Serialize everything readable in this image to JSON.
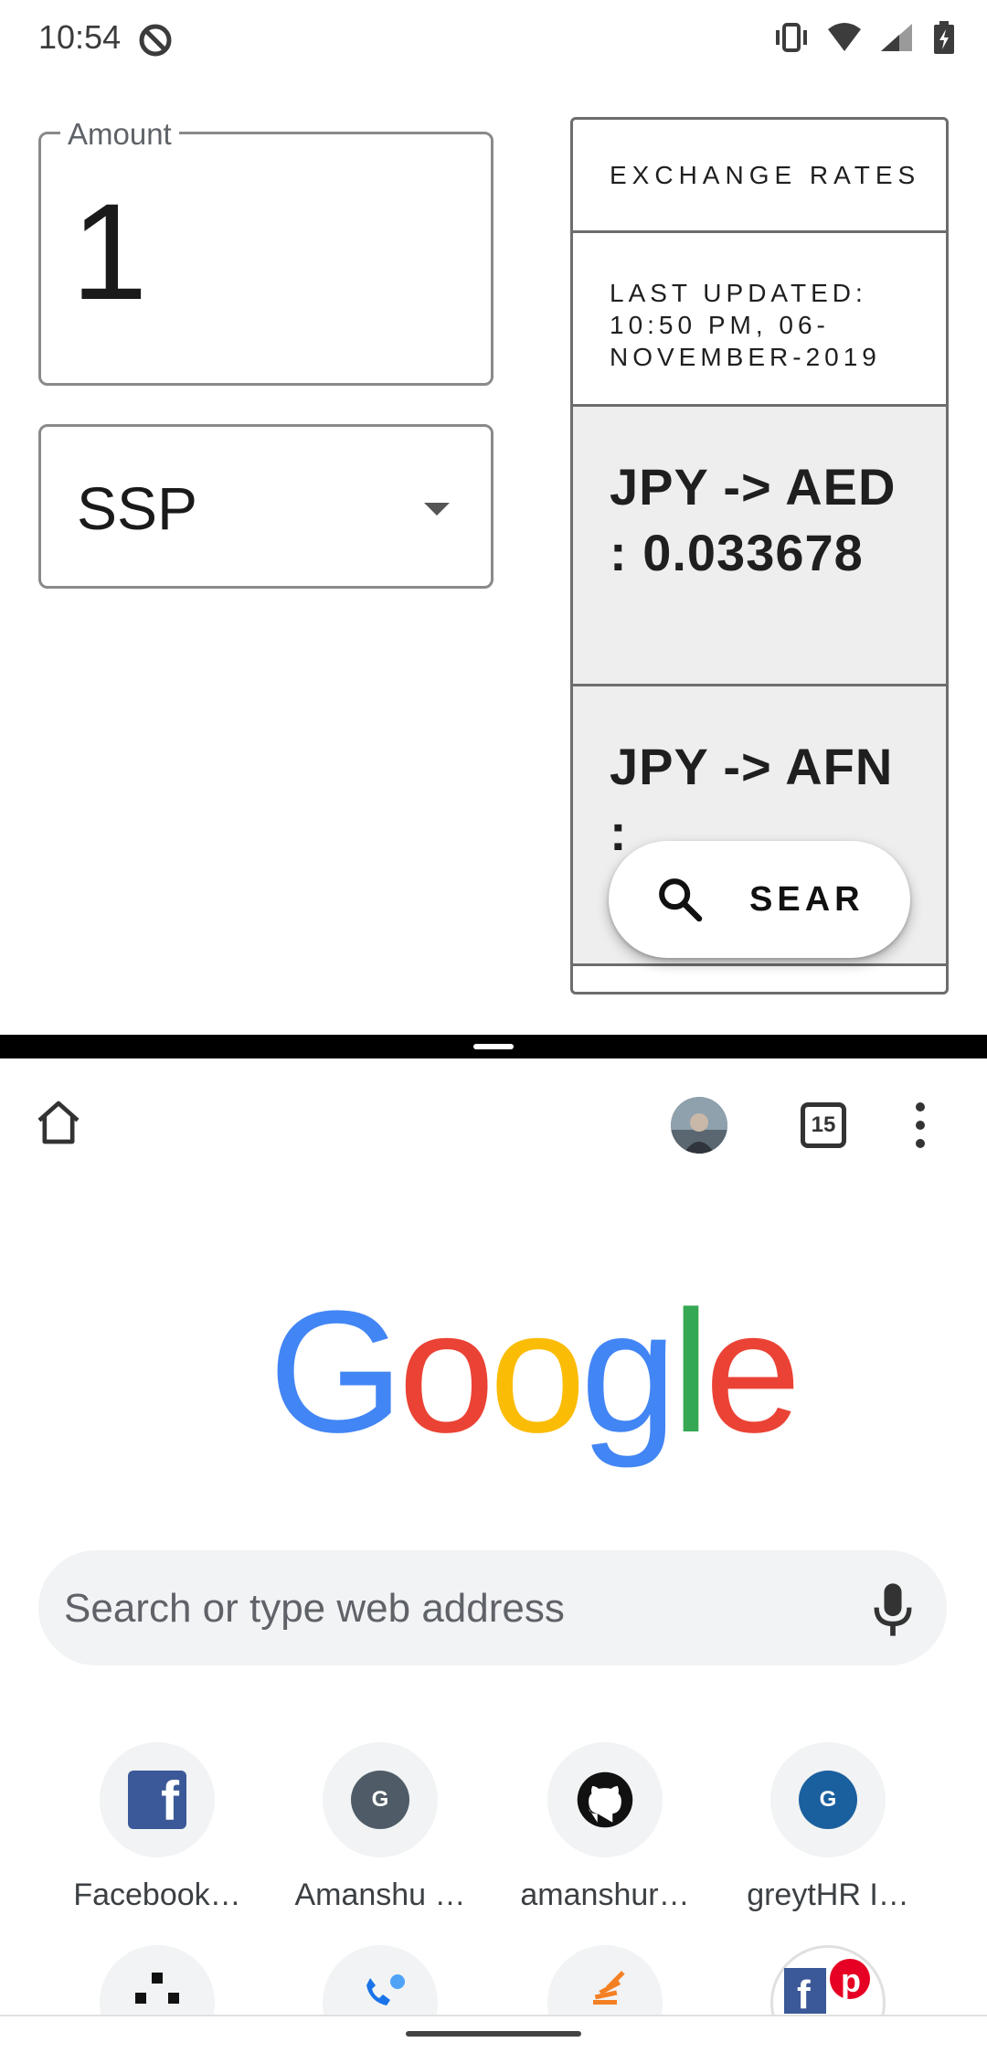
{
  "status_bar": {
    "time": "10:54"
  },
  "converter": {
    "amount_label": "Amount",
    "amount_value": "1",
    "currency_selected": "SSP"
  },
  "rates_panel": {
    "header": "EXCHANGE RATES",
    "last_updated": "LAST UPDATED: 10:50 PM, 06-NOVEMBER-2019",
    "rates": [
      {
        "text": "JPY -> AED : 0.033678"
      },
      {
        "text": "JPY -> AFN :"
      }
    ]
  },
  "fab": {
    "label": "SEAR",
    "icon": "search-icon"
  },
  "browser": {
    "tab_count": "15",
    "search_placeholder": "Search or type web address",
    "logo_letters": [
      "G",
      "o",
      "o",
      "g",
      "l",
      "e"
    ],
    "logo_colors": [
      "#4285F4",
      "#EA4335",
      "#FBBC05",
      "#4285F4",
      "#34A853",
      "#EA4335"
    ],
    "tiles": [
      {
        "label": "Facebook…",
        "icon": "facebook-icon"
      },
      {
        "label": "Amanshu …",
        "icon": "letter-g-icon"
      },
      {
        "label": "amanshur…",
        "icon": "github-icon"
      },
      {
        "label": "greytHR I…",
        "icon": "letter-g-icon"
      }
    ],
    "tile_letter": "G"
  }
}
